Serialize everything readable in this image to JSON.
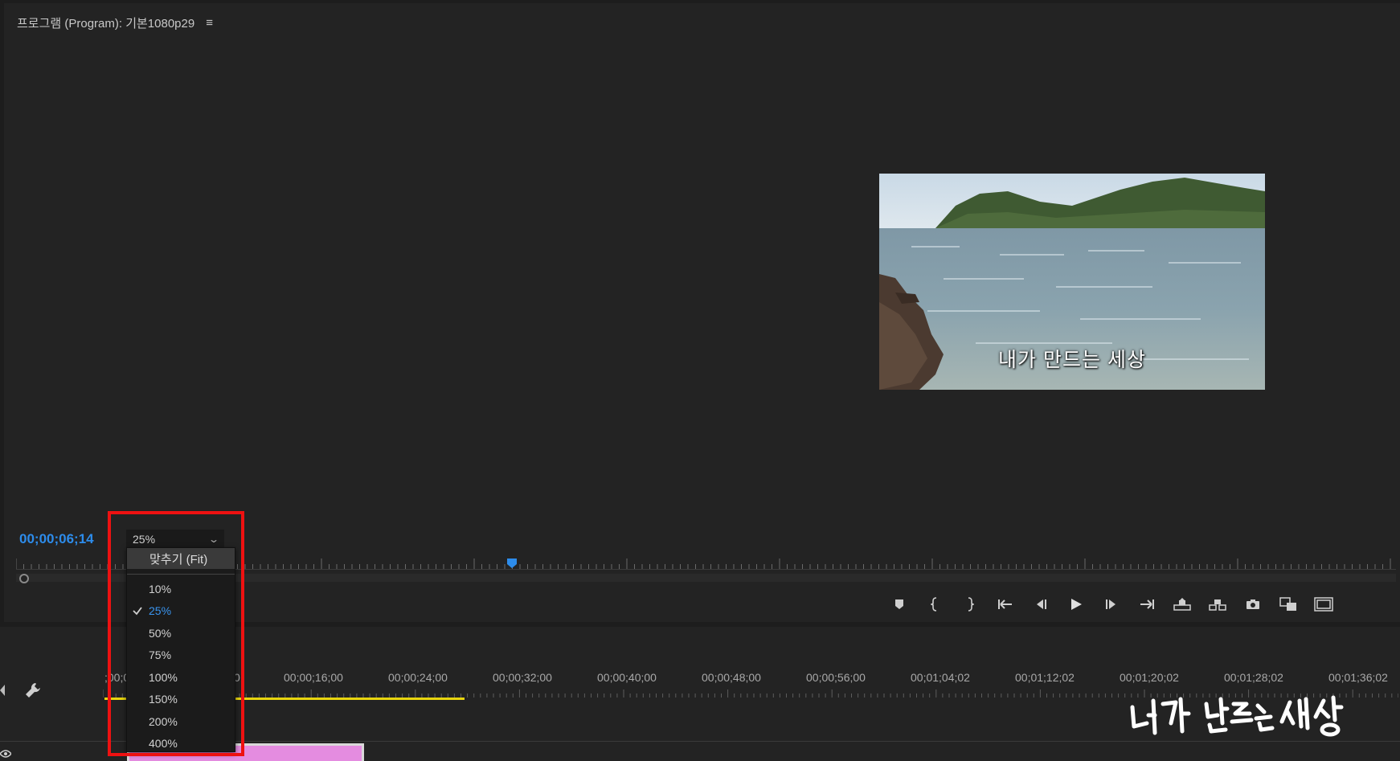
{
  "panel": {
    "title": "프로그램 (Program): 기본1080p29",
    "menu_icon": "hamburger-menu-icon"
  },
  "monitor": {
    "subtitle": "내가 만드는 세상",
    "timecode": "00;00;06;14",
    "zoom_value": "25%"
  },
  "zoom_menu": {
    "fit_label": "맞추기 (Fit)",
    "options": [
      "10%",
      "25%",
      "50%",
      "75%",
      "100%",
      "150%",
      "200%",
      "400%"
    ],
    "selected": "25%"
  },
  "transport_icons": [
    "add-marker-icon",
    "mark-in-icon",
    "mark-out-icon",
    "go-to-in-icon",
    "step-back-icon",
    "play-icon",
    "step-forward-icon",
    "go-to-out-icon",
    "lift-icon",
    "extract-icon",
    "export-frame-icon",
    "comparison-view-icon",
    "safe-margins-icon"
  ],
  "timeline": {
    "ruler_labels": [
      "00;00;16;00",
      "00;00;24;00",
      "00;00;32;00",
      "00;00;40;00",
      "00;00;48;00",
      "00;00;56;00",
      "00;01;04;02",
      "00;01;12;02",
      "00;01;20;02",
      "00;01;28;02",
      "00;01;36;02"
    ],
    "partial_left_label": ";00;0",
    "partial_right_label": "0"
  },
  "watermark": {
    "text": "내가 만드는 세상"
  },
  "colors": {
    "accent_blue": "#2d8ceb",
    "work_area_yellow": "#e8d50e",
    "clip_pink": "#e48ce0",
    "highlight_red": "#ee1111"
  }
}
